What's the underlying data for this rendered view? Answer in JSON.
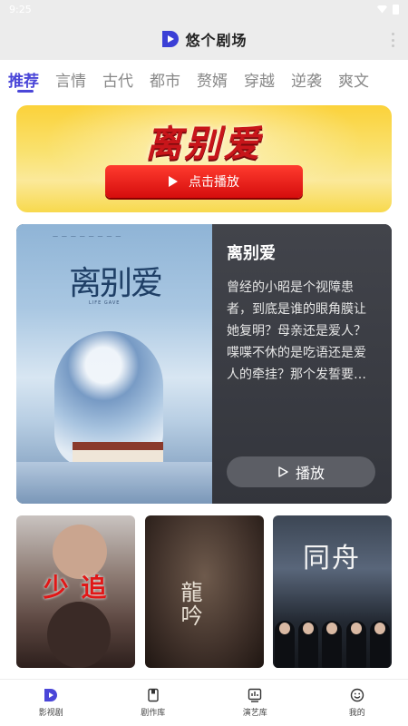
{
  "status_bar": {
    "time": "9:25"
  },
  "app": {
    "title": "悠个剧场",
    "accent": "#4a46d8"
  },
  "tabs": [
    {
      "label": "推荐",
      "active": true
    },
    {
      "label": "言情",
      "active": false
    },
    {
      "label": "古代",
      "active": false
    },
    {
      "label": "都市",
      "active": false
    },
    {
      "label": "赘婿",
      "active": false
    },
    {
      "label": "穿越",
      "active": false
    },
    {
      "label": "逆袭",
      "active": false
    },
    {
      "label": "爽文",
      "active": false
    }
  ],
  "banner": {
    "title": "离别爱",
    "button_label": "点击播放",
    "button_icon": "play-icon"
  },
  "featured": {
    "poster_title": "离别爱",
    "poster_subtitle": "LIFE GAVE",
    "title": "离别爱",
    "description": "曾经的小昭是个视障患者，到底是谁的眼角膜让她复明？母亲还是爱人？喋喋不休的是吃语还是爱人的牵挂？那个发誓要…",
    "play_label": "播放"
  },
  "thumbnails": [
    {
      "overlay_text": "少 追"
    },
    {
      "overlay_text": "龍吟"
    },
    {
      "overlay_text": "同舟"
    }
  ],
  "bottom_nav": [
    {
      "label": "影视剧",
      "icon": "play-logo-icon",
      "active": true
    },
    {
      "label": "剧作库",
      "icon": "book-icon",
      "active": false
    },
    {
      "label": "演艺库",
      "icon": "chart-icon",
      "active": false
    },
    {
      "label": "我的",
      "icon": "smiley-icon",
      "active": false
    }
  ]
}
